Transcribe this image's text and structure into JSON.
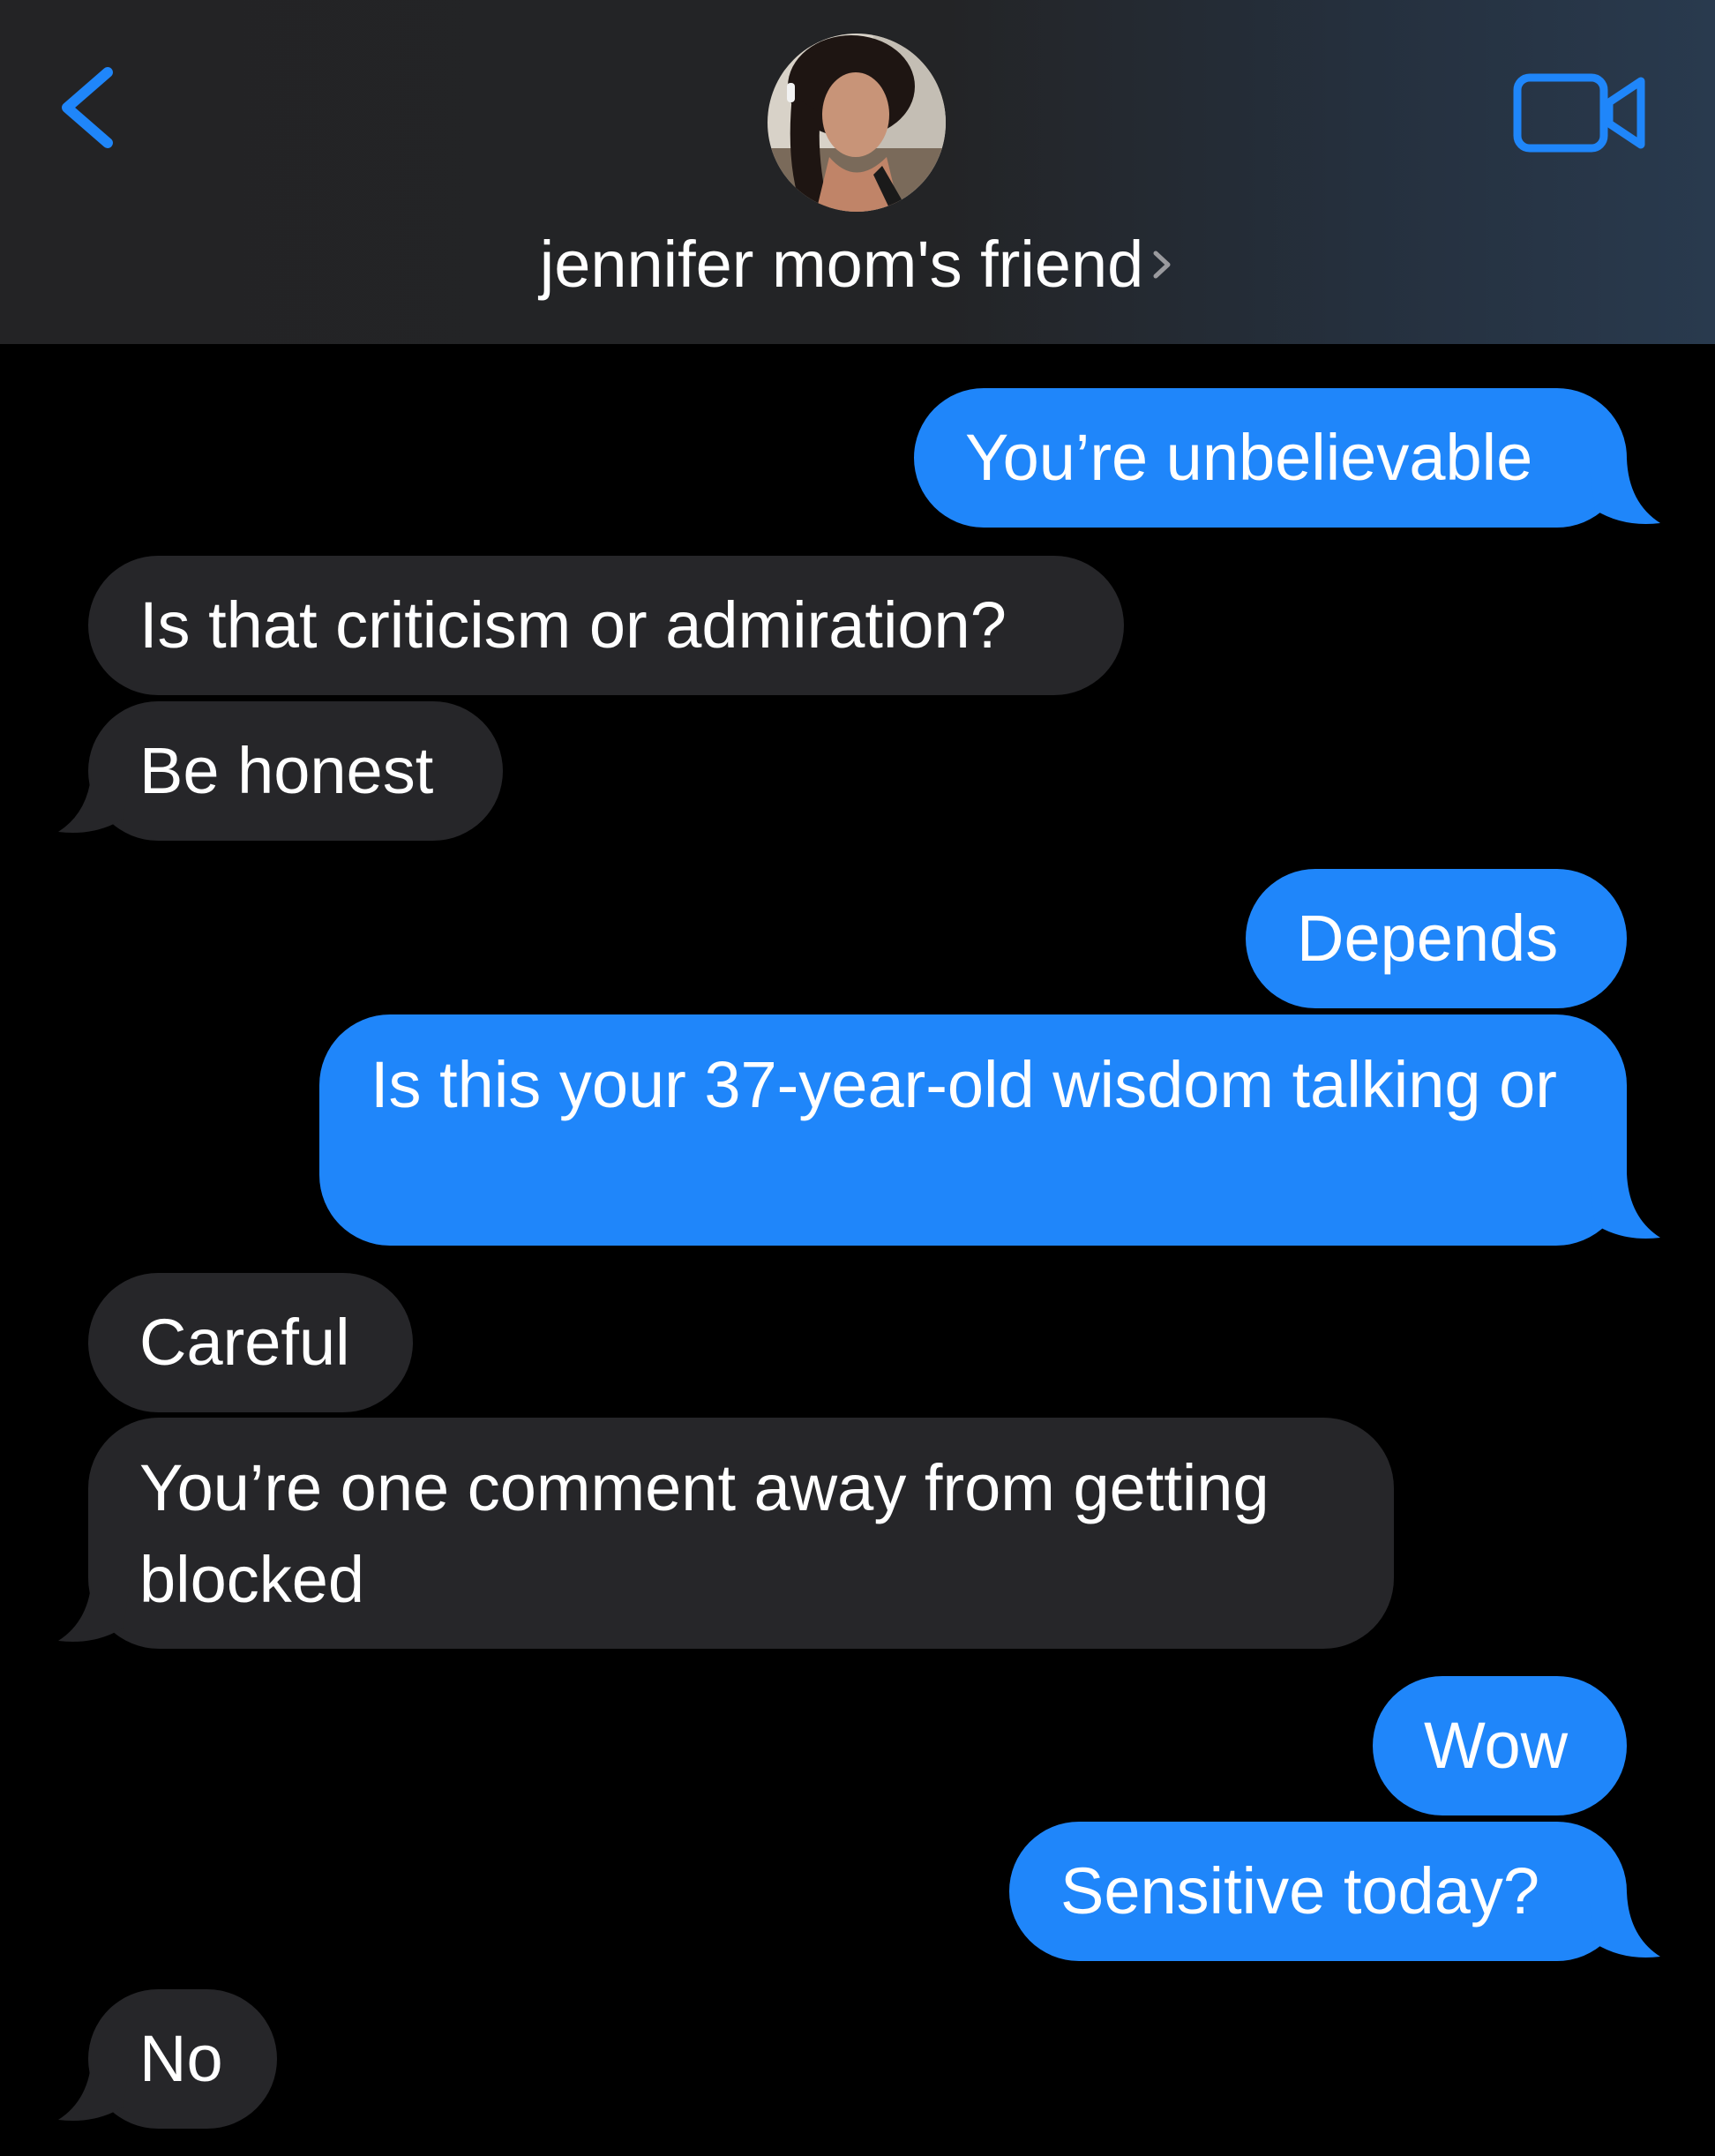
{
  "header": {
    "contact_name": "jennifer mom's friend",
    "back_icon": "chevron-left-icon",
    "video_icon": "video-camera-icon",
    "accent_color": "#1f86fa"
  },
  "messages": [
    {
      "side": "out",
      "text": "You’re unbelievable"
    },
    {
      "side": "in",
      "text": "Is that criticism or admiration?"
    },
    {
      "side": "in",
      "text": "Be honest"
    },
    {
      "side": "out",
      "text": "Depends"
    },
    {
      "side": "out",
      "text": "Is this your 37-year-old wisdom talking or"
    },
    {
      "side": "in",
      "text": "Careful"
    },
    {
      "side": "in",
      "text": "You’re one comment away from getting blocked"
    },
    {
      "side": "out",
      "text": "Wow"
    },
    {
      "side": "out",
      "text": "Sensitive today?"
    },
    {
      "side": "in",
      "text": "No"
    }
  ],
  "colors": {
    "outgoing_bubble": "#1f86fa",
    "incoming_bubble": "#262629",
    "background": "#000000"
  }
}
